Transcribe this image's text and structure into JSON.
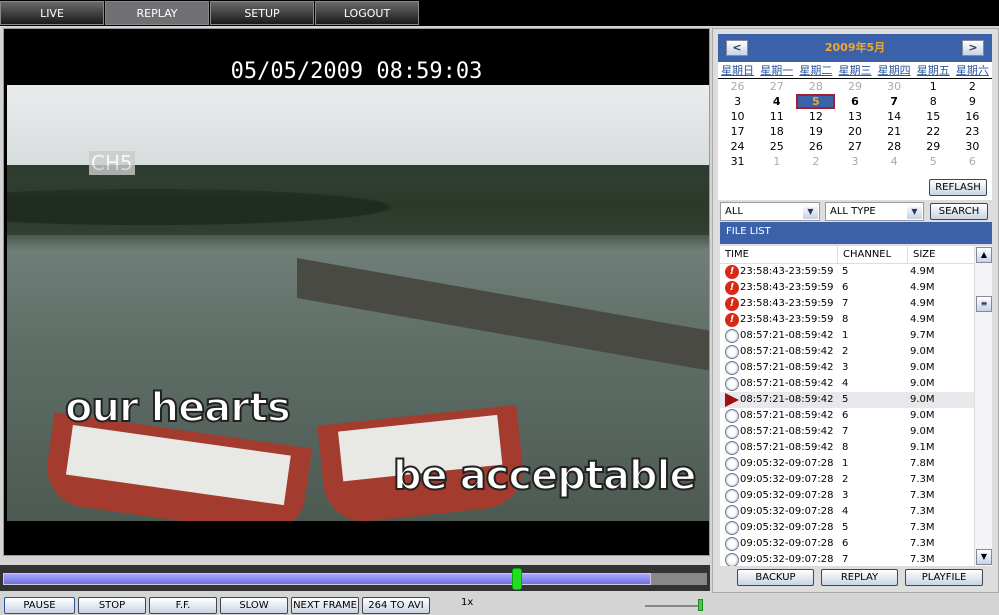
{
  "nav": {
    "tabs": [
      {
        "label": "LIVE"
      },
      {
        "label": "REPLAY",
        "active": true
      },
      {
        "label": "SETUP"
      },
      {
        "label": "LOGOUT"
      }
    ]
  },
  "video": {
    "timestamp": "05/05/2009 08:59:03",
    "channel_label": "CH5",
    "subtitle_1": "our hearts",
    "subtitle_2": "be acceptable"
  },
  "playback": {
    "progress_percent": 92,
    "position_percent": 73,
    "speed": "1x",
    "volume_percent": 100,
    "buttons": {
      "pause": "PAUSE",
      "stop": "STOP",
      "ff": "F.F.",
      "slow": "SLOW",
      "next_frame": "NEXT FRAME",
      "convert": "264 TO AVI"
    }
  },
  "calendar": {
    "title": "2009年5月",
    "prev": "<",
    "next": ">",
    "weekdays": [
      "星期日",
      "星期一",
      "星期二",
      "星期三",
      "星期四",
      "星期五",
      "星期六"
    ],
    "weeks": [
      [
        {
          "d": "26",
          "o": 1
        },
        {
          "d": "27",
          "o": 1
        },
        {
          "d": "28",
          "o": 1
        },
        {
          "d": "29",
          "o": 1
        },
        {
          "d": "30",
          "o": 1
        },
        {
          "d": "1"
        },
        {
          "d": "2"
        }
      ],
      [
        {
          "d": "3"
        },
        {
          "d": "4",
          "b": 1
        },
        {
          "d": "5",
          "sel": 1
        },
        {
          "d": "6",
          "b": 1
        },
        {
          "d": "7",
          "b": 1
        },
        {
          "d": "8"
        },
        {
          "d": "9"
        }
      ],
      [
        {
          "d": "10"
        },
        {
          "d": "11"
        },
        {
          "d": "12"
        },
        {
          "d": "13"
        },
        {
          "d": "14"
        },
        {
          "d": "15"
        },
        {
          "d": "16"
        }
      ],
      [
        {
          "d": "17"
        },
        {
          "d": "18"
        },
        {
          "d": "19"
        },
        {
          "d": "20"
        },
        {
          "d": "21"
        },
        {
          "d": "22"
        },
        {
          "d": "23"
        }
      ],
      [
        {
          "d": "24"
        },
        {
          "d": "25"
        },
        {
          "d": "26"
        },
        {
          "d": "27"
        },
        {
          "d": "28"
        },
        {
          "d": "29"
        },
        {
          "d": "30"
        }
      ],
      [
        {
          "d": "31"
        },
        {
          "d": "1",
          "o": 1
        },
        {
          "d": "2",
          "o": 1
        },
        {
          "d": "3",
          "o": 1
        },
        {
          "d": "4",
          "o": 1
        },
        {
          "d": "5",
          "o": 1
        },
        {
          "d": "6",
          "o": 1
        }
      ]
    ],
    "refresh": "REFLASH"
  },
  "filter": {
    "channel": "ALL",
    "type": "ALL TYPE",
    "search": "SEARCH"
  },
  "file_list": {
    "title": "FILE LIST",
    "columns": [
      "TIME",
      "CHANNEL",
      "SIZE"
    ],
    "rows": [
      {
        "icon": "alarm-icon",
        "time": "23:58:43-23:59:59",
        "channel": "5",
        "size": "4.9M"
      },
      {
        "icon": "alarm-icon",
        "time": "23:58:43-23:59:59",
        "channel": "6",
        "size": "4.9M"
      },
      {
        "icon": "alarm-icon",
        "time": "23:58:43-23:59:59",
        "channel": "7",
        "size": "4.9M"
      },
      {
        "icon": "alarm-icon",
        "time": "23:58:43-23:59:59",
        "channel": "8",
        "size": "4.9M"
      },
      {
        "icon": "clock-icon",
        "time": "08:57:21-08:59:42",
        "channel": "1",
        "size": "9.7M"
      },
      {
        "icon": "clock-icon",
        "time": "08:57:21-08:59:42",
        "channel": "2",
        "size": "9.0M"
      },
      {
        "icon": "clock-icon",
        "time": "08:57:21-08:59:42",
        "channel": "3",
        "size": "9.0M"
      },
      {
        "icon": "clock-icon",
        "time": "08:57:21-08:59:42",
        "channel": "4",
        "size": "9.0M"
      },
      {
        "icon": "playing-icon",
        "time": "08:57:21-08:59:42",
        "channel": "5",
        "size": "9.0M",
        "current": true
      },
      {
        "icon": "clock-icon",
        "time": "08:57:21-08:59:42",
        "channel": "6",
        "size": "9.0M"
      },
      {
        "icon": "clock-icon",
        "time": "08:57:21-08:59:42",
        "channel": "7",
        "size": "9.0M"
      },
      {
        "icon": "clock-icon",
        "time": "08:57:21-08:59:42",
        "channel": "8",
        "size": "9.1M"
      },
      {
        "icon": "clock-icon",
        "time": "09:05:32-09:07:28",
        "channel": "1",
        "size": "7.8M"
      },
      {
        "icon": "clock-icon",
        "time": "09:05:32-09:07:28",
        "channel": "2",
        "size": "7.3M"
      },
      {
        "icon": "clock-icon",
        "time": "09:05:32-09:07:28",
        "channel": "3",
        "size": "7.3M"
      },
      {
        "icon": "clock-icon",
        "time": "09:05:32-09:07:28",
        "channel": "4",
        "size": "7.3M"
      },
      {
        "icon": "clock-icon",
        "time": "09:05:32-09:07:28",
        "channel": "5",
        "size": "7.3M"
      },
      {
        "icon": "clock-icon",
        "time": "09:05:32-09:07:28",
        "channel": "6",
        "size": "7.3M"
      },
      {
        "icon": "clock-icon",
        "time": "09:05:32-09:07:28",
        "channel": "7",
        "size": "7.3M"
      }
    ]
  },
  "actions": {
    "backup": "BACKUP",
    "replay": "REPLAY",
    "playfile": "PLAYFILE"
  }
}
